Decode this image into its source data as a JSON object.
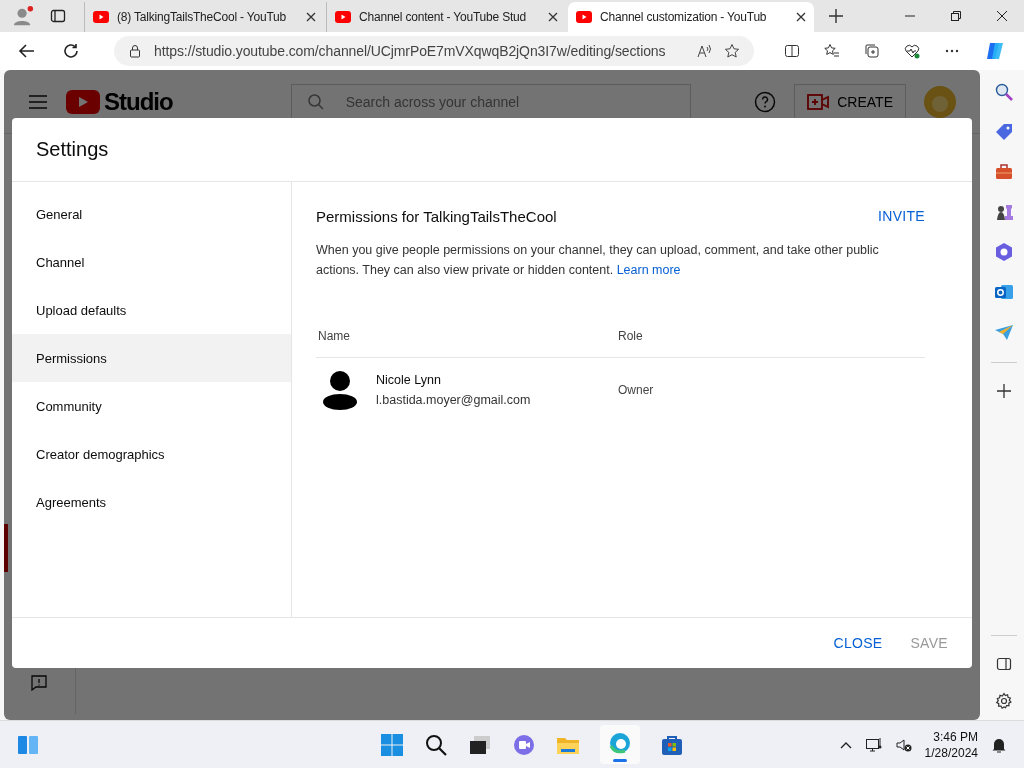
{
  "browser": {
    "tabs": [
      {
        "title": "(8) TalkingTailsTheCool - YouTub",
        "selected": false
      },
      {
        "title": "Channel content - YouTube Stud",
        "selected": false
      },
      {
        "title": "Channel customization - YouTub",
        "selected": true
      }
    ],
    "url": "https://studio.youtube.com/channel/UCjmrPoE7mVXqwqB2jQn3I7w/editing/sections"
  },
  "studio": {
    "logo": "Studio",
    "search": {
      "placeholder": "Search across your channel"
    },
    "create": "CREATE"
  },
  "dialog": {
    "title": "Settings",
    "nav": [
      {
        "label": "General",
        "selected": false
      },
      {
        "label": "Channel",
        "selected": false
      },
      {
        "label": "Upload defaults",
        "selected": false
      },
      {
        "label": "Permissions",
        "selected": true
      },
      {
        "label": "Community",
        "selected": false
      },
      {
        "label": "Creator demographics",
        "selected": false
      },
      {
        "label": "Agreements",
        "selected": false
      }
    ],
    "heading": "Permissions for TalkingTailsTheCool",
    "invite": "INVITE",
    "description": "When you give people permissions on your channel, they can upload, comment, and take other public actions. They can also view private or hidden content.",
    "learn_more": "Learn more",
    "columns": [
      "Name",
      "Role"
    ],
    "rows": [
      {
        "name": "Nicole Lynn",
        "email": "l.bastida.moyer@gmail.com",
        "role": "Owner"
      }
    ],
    "buttons": [
      {
        "label": "CLOSE",
        "disabled": false
      },
      {
        "label": "SAVE",
        "disabled": true
      }
    ]
  },
  "taskbar": {
    "time": "3:46 PM",
    "date": "1/28/2024"
  }
}
